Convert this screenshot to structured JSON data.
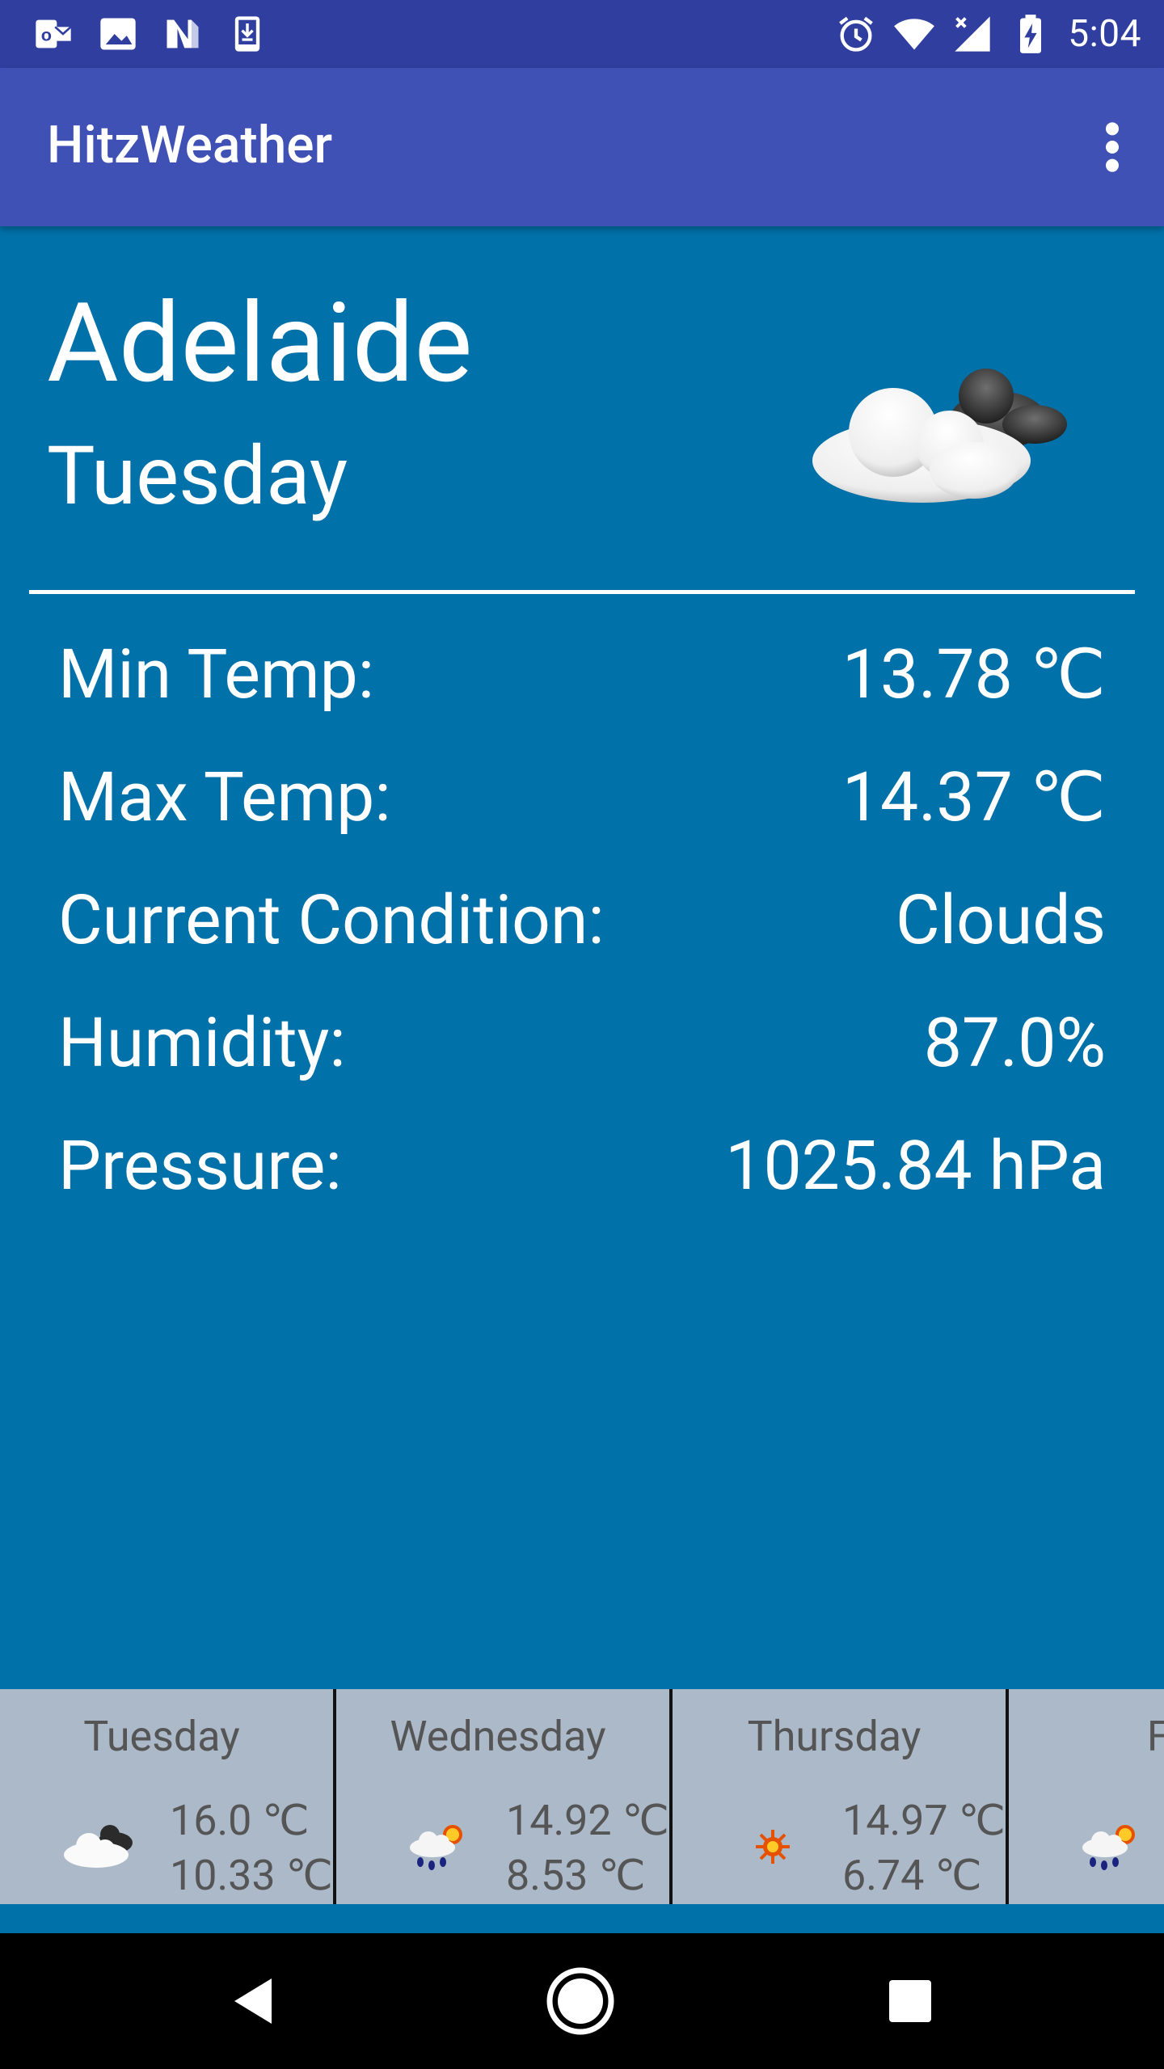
{
  "status_bar": {
    "time": "5:04",
    "left_icons": [
      "outlook-icon",
      "image-icon",
      "n-icon",
      "download-icon"
    ],
    "right_icons": [
      "alarm-icon",
      "wifi-icon",
      "signal-icon",
      "battery-charging-icon"
    ]
  },
  "app_bar": {
    "title": "HitzWeather",
    "menu_icon": "overflow-menu-icon"
  },
  "current": {
    "city": "Adelaide",
    "day": "Tuesday",
    "icon": "partly-cloudy-icon",
    "rows": [
      {
        "label": "Min Temp:",
        "value": "13.78 ℃"
      },
      {
        "label": "Max Temp:",
        "value": "14.37 ℃"
      },
      {
        "label": "Current Condition:",
        "value": "Clouds"
      },
      {
        "label": "Humidity:",
        "value": "87.0%"
      },
      {
        "label": "Pressure:",
        "value": "1025.84 hPa"
      }
    ]
  },
  "forecast": [
    {
      "day": "Tuesday",
      "high": "16.0 ℃",
      "low": "10.33 ℃",
      "icon": "clouds-icon"
    },
    {
      "day": "Wednesday",
      "high": "14.92 ℃",
      "low": "8.53 ℃",
      "icon": "rain-sun-icon"
    },
    {
      "day": "Thursday",
      "high": "14.97 ℃",
      "low": "6.74 ℃",
      "icon": "sun-icon"
    },
    {
      "day": "Fri",
      "high": "",
      "low": "",
      "icon": "rain-sun-icon"
    }
  ],
  "nav_bar": {
    "buttons": [
      "back-icon",
      "home-icon",
      "recents-icon"
    ]
  },
  "colors": {
    "status_bar": "#303f9f",
    "app_bar": "#3f51b5",
    "background": "#0071a9",
    "forecast_bg": "#abb9c9"
  }
}
